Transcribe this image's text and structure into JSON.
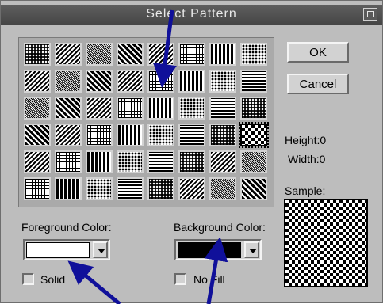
{
  "window": {
    "title": "Select Pattern"
  },
  "buttons": {
    "ok": "OK",
    "cancel": "Cancel"
  },
  "info": {
    "height": "Height:0",
    "width": "Width:0",
    "sample_label": "Sample:"
  },
  "foreground": {
    "label": "Foreground Color:",
    "color": "#ffffff",
    "checkbox_label": "Solid",
    "checked": false
  },
  "background": {
    "label": "Background Color:",
    "color": "#000000",
    "checkbox_label": "No Fill",
    "checked": false
  },
  "patterns": {
    "columns": 8,
    "rows": 6,
    "selected_index": 31
  },
  "annotation": {
    "color": "#10109a",
    "icon": "arrow-icon"
  }
}
